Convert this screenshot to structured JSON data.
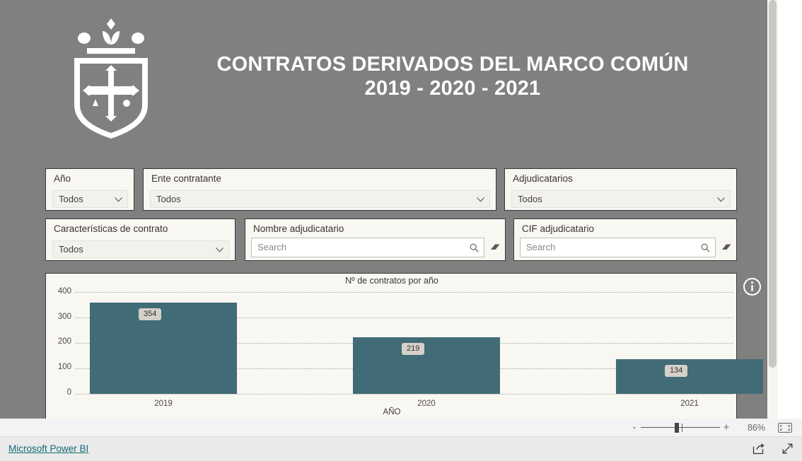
{
  "report": {
    "title_line1": "CONTRATOS DERIVADOS DEL MARCO COMÚN",
    "title_line2": "2019 - 2020 - 2021",
    "crest_icon": "asturias-coat-of-arms-icon",
    "canvas_bg": "#808080",
    "visual_bg": "#f8f7f2",
    "accent": "#416b76"
  },
  "slicers": [
    {
      "label": "Año",
      "value": "Todos",
      "icon": "chevron-down-icon"
    },
    {
      "label": "Ente contratante",
      "value": "Todos",
      "icon": "chevron-down-icon"
    },
    {
      "label": "Adjudicatarios",
      "value": "Todos",
      "icon": "chevron-down-icon"
    },
    {
      "label": "Características de contrato",
      "value": "Todos",
      "icon": "chevron-down-icon"
    }
  ],
  "search_slicers": [
    {
      "label": "Nombre adjudicatario",
      "value": "",
      "placeholder": "Search",
      "search_icon": "search-icon",
      "clear_icon": "eraser-icon"
    },
    {
      "label": "CIF adjudicatario",
      "value": "",
      "placeholder": "Search",
      "search_icon": "search-icon",
      "clear_icon": "eraser-icon"
    }
  ],
  "chart_data": {
    "type": "bar",
    "title": "Nº de contratos por año",
    "xlabel": "AÑO",
    "ylabel": "",
    "categories": [
      "2019",
      "2020",
      "2021"
    ],
    "values": [
      354,
      219,
      134
    ],
    "data_labels": [
      "354",
      "219",
      "134"
    ],
    "yticks": [
      400,
      300,
      200,
      100,
      0
    ],
    "ylim": [
      0,
      400
    ],
    "grid": true,
    "grid_style": "dotted",
    "legend": "none",
    "bar_color": "#416b76"
  },
  "chart_visual": {
    "info_icon": "info-circle-icon"
  },
  "zoom_bar": {
    "minus_label": "-",
    "plus_label": "+",
    "percent": "86%",
    "fit_icon": "fit-to-page-icon"
  },
  "footer": {
    "brand_link": "Microsoft Power BI",
    "share_icon": "share-icon",
    "fullscreen_icon": "fullscreen-icon"
  },
  "scrollbar": {
    "orientation": "vertical",
    "position": "top"
  }
}
